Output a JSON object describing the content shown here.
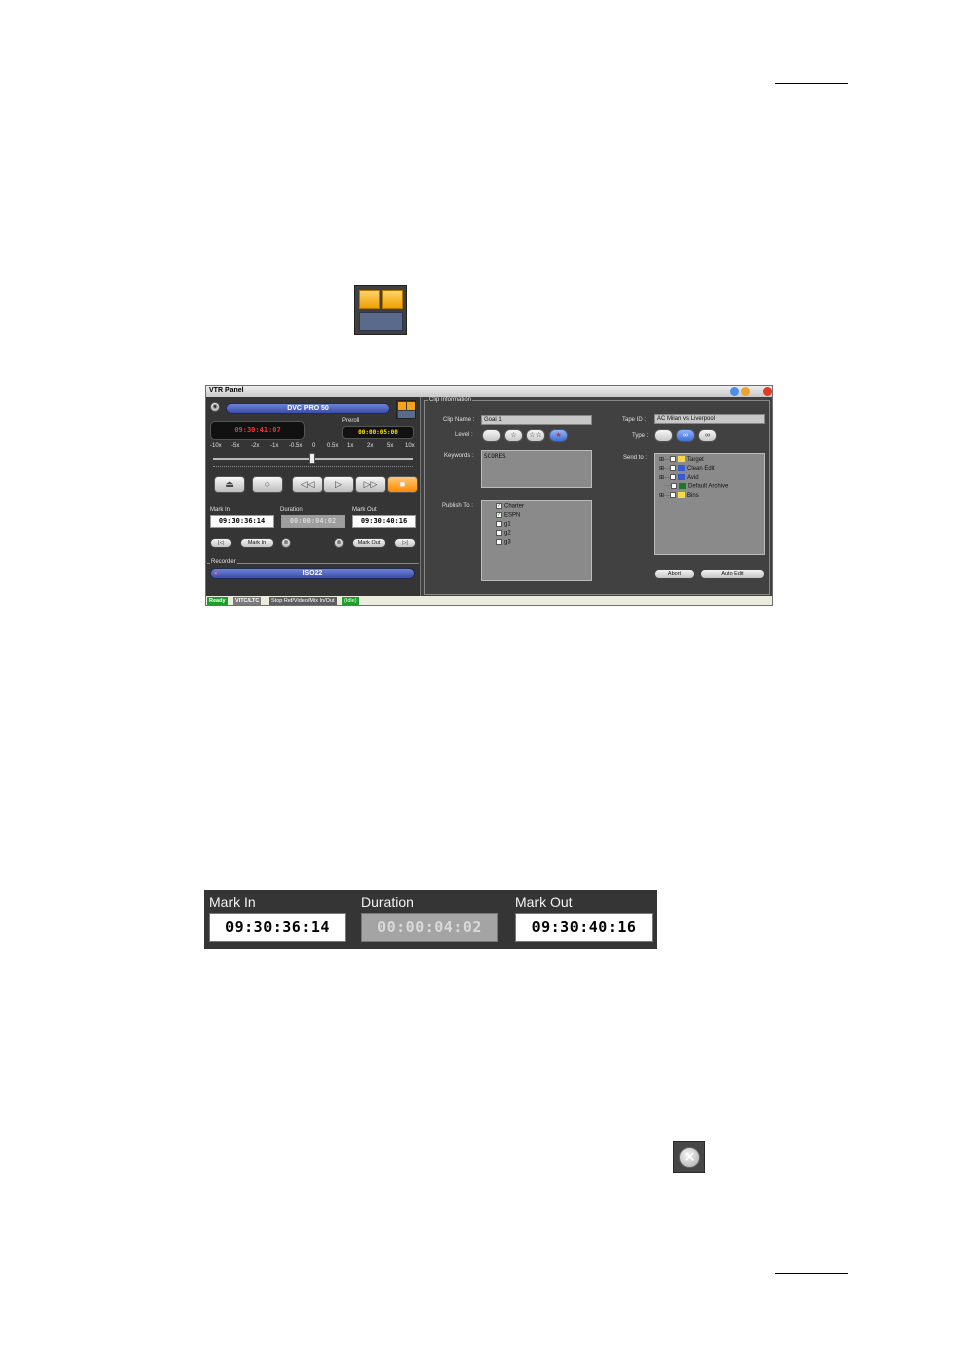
{
  "vtr_panel": {
    "title": "VTR Panel",
    "player": {
      "format": "DVC PRO 50",
      "timecode": "09:30:41:07",
      "preroll_label": "Preroll",
      "preroll": "00:00:05:00",
      "speed_ticks": [
        "-10x",
        "-5x",
        "-2x",
        "-1x",
        "-0.5x",
        "0",
        "0.5x",
        "1x",
        "2x",
        "5x",
        "10x"
      ]
    },
    "marks": {
      "mark_in_label": "Mark In",
      "duration_label": "Duration",
      "mark_out_label": "Mark Out",
      "mark_in": "09:30:36:14",
      "duration": "00:00:04:02",
      "mark_out": "09:30:40:16",
      "mark_in_button": "Mark In",
      "mark_out_button": "Mark Out"
    },
    "recorder": {
      "label": "Recorder",
      "name": "ISO22"
    },
    "clip_info": {
      "group_label": "Clip Information",
      "clip_name_label": "Clip Name :",
      "clip_name": "Goal 1",
      "level_label": "Level :",
      "keywords_label": "Keywords :",
      "keywords": "SCORES",
      "publish_label": "Publish To :",
      "publish_items": [
        {
          "label": "Charter",
          "checked": true
        },
        {
          "label": "ESPN",
          "checked": true
        },
        {
          "label": "g1",
          "checked": false
        },
        {
          "label": "g2",
          "checked": false
        },
        {
          "label": "g3",
          "checked": false
        }
      ],
      "tape_id_label": "Tape ID :",
      "tape_id": "AC Milan vs Liverpool",
      "type_label": "Type :",
      "send_to_label": "Send to :",
      "send_items": [
        {
          "label": "Target"
        },
        {
          "label": "Clean Edit"
        },
        {
          "label": "Avid"
        },
        {
          "label": "Default Archive"
        },
        {
          "label": "Bins"
        }
      ],
      "abort_button": "Abort",
      "auto_edit_button": "Auto Edit"
    },
    "status": {
      "ready": "Ready",
      "vitc": "VITC/LTC",
      "message": "Stop Ref/Video/Mix In/Out",
      "idle": "(Idle)"
    }
  },
  "enlarged": {
    "mark_in_label": "Mark In",
    "duration_label": "Duration",
    "mark_out_label": "Mark Out",
    "mark_in": "09:30:36:14",
    "duration": "00:00:04:02",
    "mark_out": "09:30:40:16"
  }
}
